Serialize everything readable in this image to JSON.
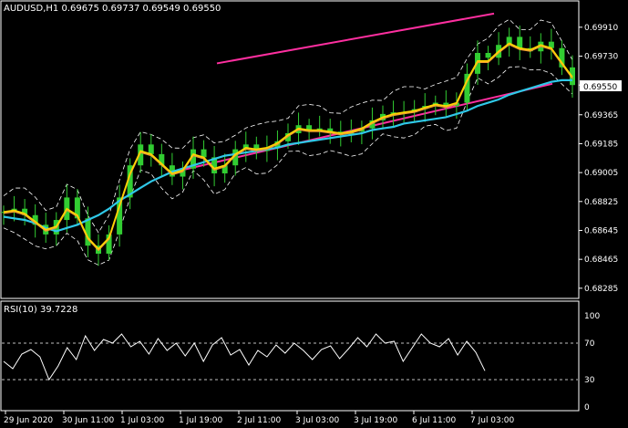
{
  "header": {
    "symbol_info": "AUDUSD,H1  0.69675 0.69737 0.69549 0.69550"
  },
  "rsi_panel": {
    "label": "RSI(10) 39.7228"
  },
  "current_price": "0.69550",
  "colors": {
    "background": "#000000",
    "bull_candle": "#32cd32",
    "channel": "#ff2fa0",
    "ma_slow": "#2fc8e8",
    "ma_fast": "#ffd700",
    "ma_mid": "#f0a030",
    "bands": "#ffffff",
    "rsi": "#ffffff"
  },
  "chart_data": [
    {
      "type": "line",
      "title": "AUDUSD,H1",
      "y_ticks": [
        "0.69910",
        "0.69730",
        "0.69550",
        "0.69365",
        "0.69185",
        "0.69005",
        "0.68825",
        "0.68645",
        "0.68465",
        "0.68285"
      ],
      "ylim": [
        0.6825,
        0.7
      ],
      "x_ticks": [
        "29 Jun 2020",
        "30 Jun 11:00",
        "1 Jul 03:00",
        "1 Jul 19:00",
        "2 Jul 11:00",
        "3 Jul 03:00",
        "3 Jul 19:00",
        "6 Jul 11:00",
        "7 Jul 03:00"
      ],
      "series": [
        {
          "name": "close",
          "style": "candles",
          "values": [
            0.6876,
            0.6878,
            0.6874,
            0.6868,
            0.6862,
            0.6871,
            0.6885,
            0.6872,
            0.6855,
            0.685,
            0.6862,
            0.6885,
            0.6905,
            0.6918,
            0.6912,
            0.6905,
            0.6898,
            0.6903,
            0.6915,
            0.691,
            0.69,
            0.6905,
            0.6915,
            0.6918,
            0.6914,
            0.6916,
            0.692,
            0.6925,
            0.693,
            0.6927,
            0.6928,
            0.6926,
            0.6924,
            0.6926,
            0.6928,
            0.6933,
            0.6937,
            0.6938,
            0.6938,
            0.694,
            0.6942,
            0.6944,
            0.6942,
            0.6944,
            0.6962,
            0.6975,
            0.6972,
            0.698,
            0.6985,
            0.6978,
            0.6976,
            0.6982,
            0.6978,
            0.6966,
            0.6955
          ]
        },
        {
          "name": "ma_slow",
          "values": [
            0.6873,
            0.6872,
            0.6871,
            0.6869,
            0.6866,
            0.6864,
            0.6866,
            0.6868,
            0.6871,
            0.6874,
            0.6878,
            0.6883,
            0.6887,
            0.6891,
            0.6895,
            0.6898,
            0.6901,
            0.6903,
            0.6905,
            0.6907,
            0.6909,
            0.6911,
            0.6912,
            0.6913,
            0.6914,
            0.6915,
            0.6916,
            0.6918,
            0.6919,
            0.692,
            0.6921,
            0.6922,
            0.6923,
            0.6924,
            0.6925,
            0.6927,
            0.6928,
            0.6929,
            0.6931,
            0.6932,
            0.6933,
            0.6934,
            0.6935,
            0.6937,
            0.6939,
            0.6942,
            0.6944,
            0.6946,
            0.6949,
            0.6951,
            0.6953,
            0.6955,
            0.6957,
            0.6958,
            0.6958
          ]
        },
        {
          "name": "ma_fast",
          "values": [
            0.6876,
            0.6877,
            0.6875,
            0.687,
            0.6865,
            0.6867,
            0.6878,
            0.6874,
            0.686,
            0.6853,
            0.686,
            0.688,
            0.69,
            0.6914,
            0.6912,
            0.6906,
            0.69,
            0.6902,
            0.6912,
            0.691,
            0.6903,
            0.6905,
            0.6912,
            0.6916,
            0.6915,
            0.6916,
            0.6919,
            0.6924,
            0.6928,
            0.6927,
            0.6927,
            0.6926,
            0.6925,
            0.6926,
            0.6928,
            0.6932,
            0.6935,
            0.6937,
            0.6938,
            0.6939,
            0.6941,
            0.6943,
            0.6942,
            0.6944,
            0.6958,
            0.697,
            0.697,
            0.6976,
            0.6981,
            0.6978,
            0.6977,
            0.698,
            0.6978,
            0.6969,
            0.696
          ]
        },
        {
          "name": "rsi",
          "values": [
            50,
            42,
            58,
            63,
            55,
            30,
            45,
            65,
            52,
            78,
            62,
            74,
            70,
            80,
            66,
            72,
            58,
            75,
            62,
            70,
            56,
            70,
            50,
            68,
            76,
            57,
            63,
            46,
            62,
            55,
            68,
            59,
            70,
            62,
            52,
            63,
            67,
            53,
            64,
            76,
            66,
            80,
            70,
            72,
            50,
            65,
            80,
            70,
            66,
            75,
            57,
            72,
            60,
            39.7
          ]
        }
      ]
    }
  ]
}
